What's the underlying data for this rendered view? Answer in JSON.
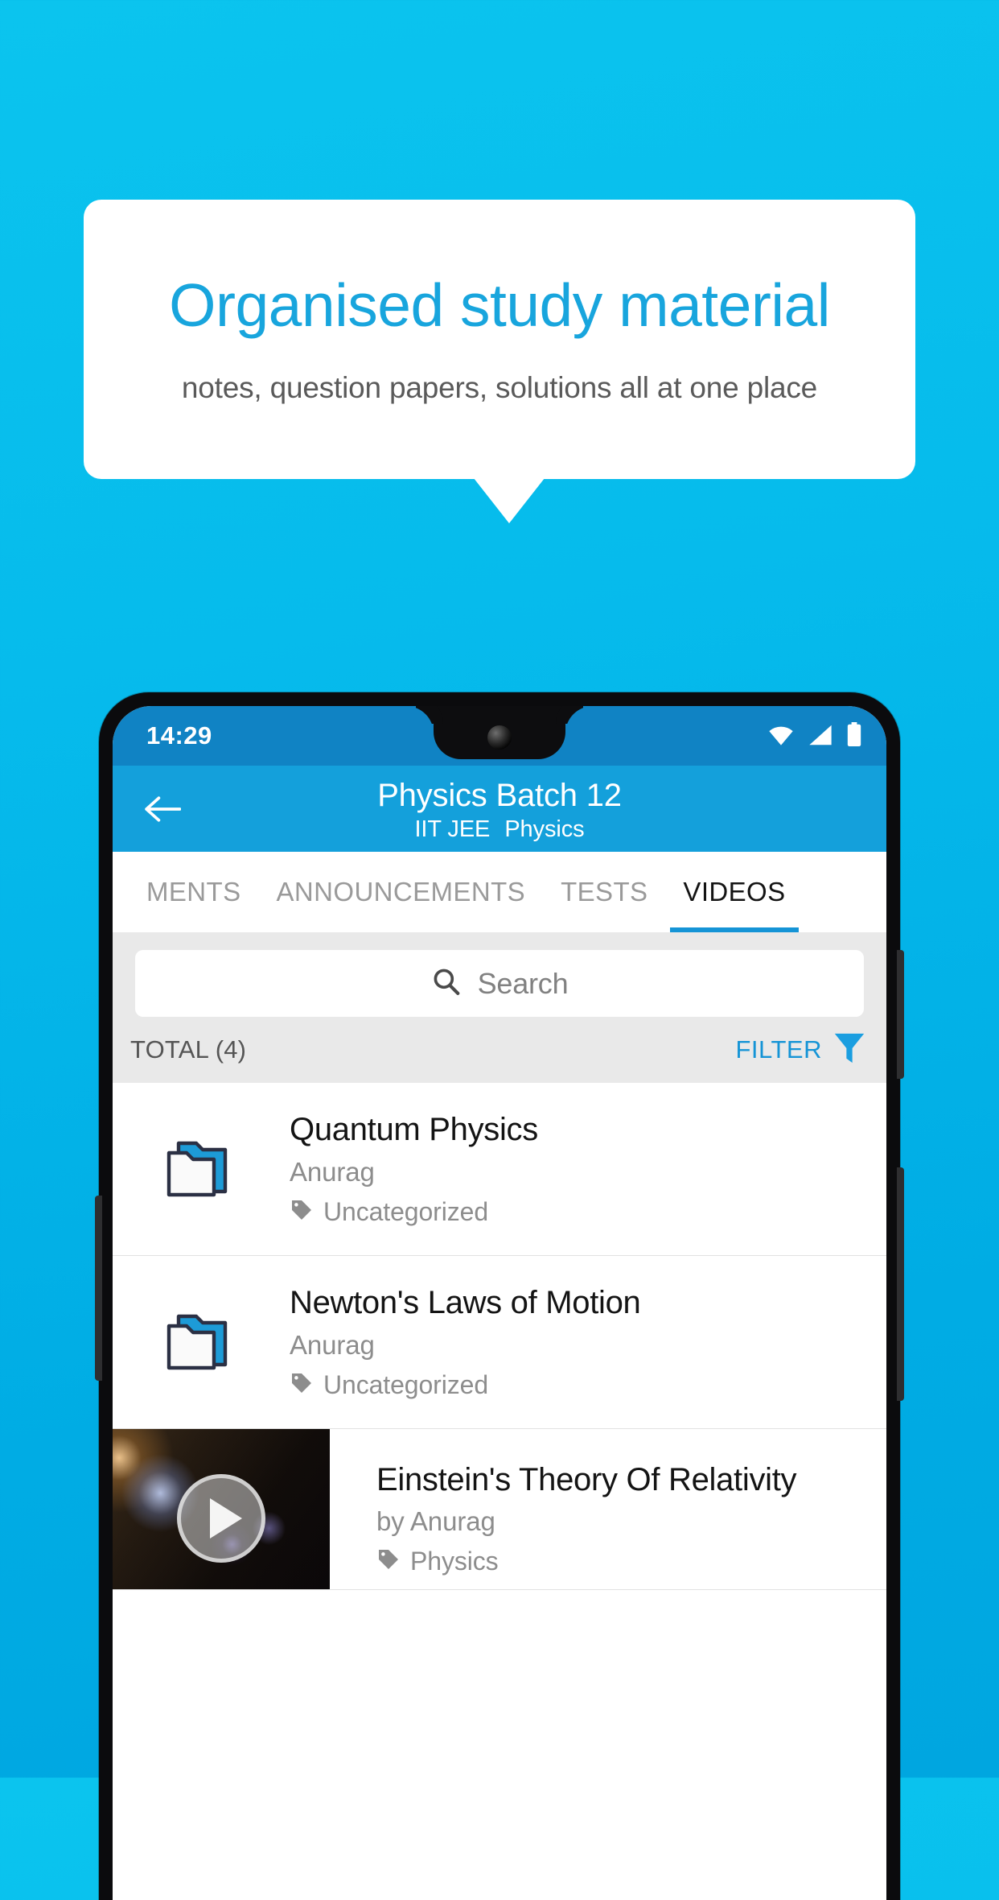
{
  "promo": {
    "title": "Organised study material",
    "subtitle": "notes, question papers, solutions all at one place"
  },
  "theme": {
    "background_top": "#0bc4ee",
    "background_bottom": "#00a6e0",
    "card_background": "#ffffff",
    "title_color": "#18a5dd",
    "appbar_color": "#14a0db",
    "statusbar_color": "#1083c4",
    "accent": "#1594d6"
  },
  "phone": {
    "statusbar": {
      "clock": "14:29",
      "icons": [
        "wifi-icon",
        "signal-icon",
        "battery-icon"
      ]
    },
    "appbar": {
      "back_icon": "back-arrow-icon",
      "title": "Physics Batch 12",
      "subtitle_left": "IIT JEE",
      "subtitle_right": "Physics"
    },
    "tabs": [
      {
        "label": "MENTS",
        "active": false
      },
      {
        "label": "ANNOUNCEMENTS",
        "active": false
      },
      {
        "label": "TESTS",
        "active": false
      },
      {
        "label": "VIDEOS",
        "active": true
      }
    ],
    "search": {
      "placeholder": "Search",
      "icon": "search-icon"
    },
    "toolbar": {
      "total_label": "TOTAL (4)",
      "filter_label": "FILTER",
      "filter_icon": "filter-funnel-icon"
    },
    "list": [
      {
        "type": "folder",
        "icon": "folder-icon",
        "title": "Quantum Physics",
        "author": "Anurag",
        "tag": "Uncategorized",
        "tag_icon": "tag-icon"
      },
      {
        "type": "folder",
        "icon": "folder-icon",
        "title": "Newton's Laws of Motion",
        "author": "Anurag",
        "tag": "Uncategorized",
        "tag_icon": "tag-icon"
      },
      {
        "type": "video",
        "icon": "video-thumbnail",
        "play_icon": "play-icon",
        "title": "Einstein's Theory Of Relativity",
        "author": "by Anurag",
        "tag": "Physics",
        "tag_icon": "tag-icon"
      }
    ]
  }
}
